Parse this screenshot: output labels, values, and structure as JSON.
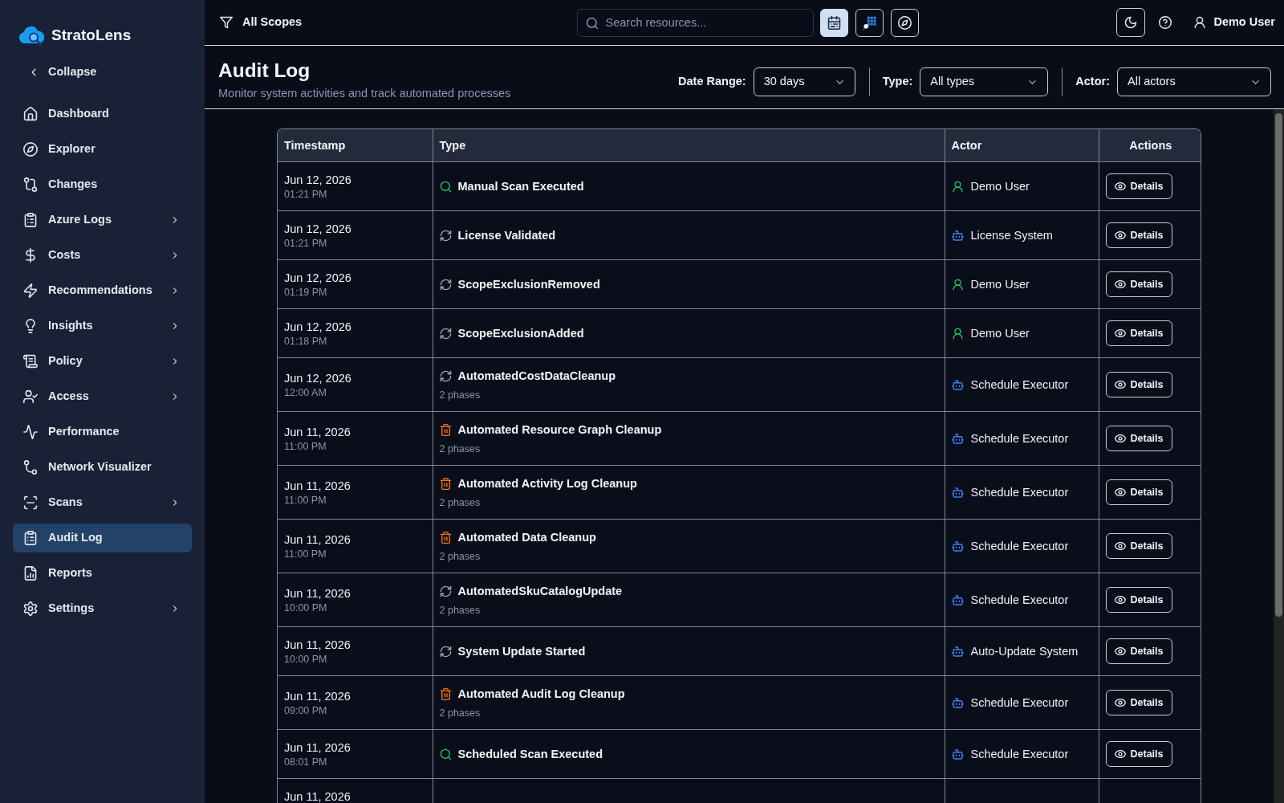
{
  "app": {
    "name": "StratoLens"
  },
  "sidebar": {
    "collapse_label": "Collapse",
    "items": [
      {
        "label": "Dashboard",
        "selected": false,
        "has_submenu": false
      },
      {
        "label": "Explorer",
        "selected": false,
        "has_submenu": false
      },
      {
        "label": "Changes",
        "selected": false,
        "has_submenu": false
      },
      {
        "label": "Azure Logs",
        "selected": false,
        "has_submenu": true
      },
      {
        "label": "Costs",
        "selected": false,
        "has_submenu": true
      },
      {
        "label": "Recommendations",
        "selected": false,
        "has_submenu": true
      },
      {
        "label": "Insights",
        "selected": false,
        "has_submenu": true
      },
      {
        "label": "Policy",
        "selected": false,
        "has_submenu": true
      },
      {
        "label": "Access",
        "selected": false,
        "has_submenu": true
      },
      {
        "label": "Performance",
        "selected": false,
        "has_submenu": false
      },
      {
        "label": "Network Visualizer",
        "selected": false,
        "has_submenu": false
      },
      {
        "label": "Scans",
        "selected": false,
        "has_submenu": true
      },
      {
        "label": "Audit Log",
        "selected": true,
        "has_submenu": false
      },
      {
        "label": "Reports",
        "selected": false,
        "has_submenu": false
      },
      {
        "label": "Settings",
        "selected": false,
        "has_submenu": true
      }
    ]
  },
  "top_bar": {
    "scope_filter": "All Scopes",
    "search": {
      "placeholder": "Search resources..."
    },
    "view_buttons": [
      {
        "selected": true
      },
      {
        "selected": false
      },
      {
        "selected": false
      }
    ],
    "user": "Demo User"
  },
  "header": {
    "title": "Audit Log",
    "subtitle": "Monitor system activities and track automated processes",
    "filters": [
      {
        "label": "Date Range:",
        "value": "30 days"
      },
      {
        "label": "Type:",
        "value": "All types"
      },
      {
        "label": "Actor:",
        "value": "All actors"
      }
    ]
  },
  "table": {
    "columns": [
      "Timestamp",
      "Type",
      "Actor",
      "Actions"
    ],
    "rows": [
      {
        "date": "Jun 12, 2026",
        "time": "01:21 PM",
        "event": {
          "kind": "scan",
          "label": "Manual Scan Executed"
        },
        "actor": {
          "kind": "user",
          "name": "Demo User"
        },
        "action": "Details"
      },
      {
        "date": "Jun 12, 2026",
        "time": "01:21 PM",
        "event": {
          "kind": "sync",
          "label": "License Validated"
        },
        "actor": {
          "kind": "system",
          "name": "License System"
        },
        "action": "Details"
      },
      {
        "date": "Jun 12, 2026",
        "time": "01:19 PM",
        "event": {
          "kind": "sync",
          "label": "ScopeExclusionRemoved"
        },
        "actor": {
          "kind": "user",
          "name": "Demo User"
        },
        "action": "Details"
      },
      {
        "date": "Jun 12, 2026",
        "time": "01:18 PM",
        "event": {
          "kind": "sync",
          "label": "ScopeExclusionAdded"
        },
        "actor": {
          "kind": "user",
          "name": "Demo User"
        },
        "action": "Details"
      },
      {
        "date": "Jun 12, 2026",
        "time": "12:00 AM",
        "event": {
          "kind": "sync",
          "label": "AutomatedCostDataCleanup",
          "phases": "2 phases"
        },
        "actor": {
          "kind": "system",
          "name": "Schedule Executor"
        },
        "action": "Details"
      },
      {
        "date": "Jun 11, 2026",
        "time": "11:00 PM",
        "event": {
          "kind": "cleanup",
          "label": "Automated Resource Graph Cleanup",
          "phases": "2 phases"
        },
        "actor": {
          "kind": "system",
          "name": "Schedule Executor"
        },
        "action": "Details"
      },
      {
        "date": "Jun 11, 2026",
        "time": "11:00 PM",
        "event": {
          "kind": "cleanup",
          "label": "Automated Activity Log Cleanup",
          "phases": "2 phases"
        },
        "actor": {
          "kind": "system",
          "name": "Schedule Executor"
        },
        "action": "Details"
      },
      {
        "date": "Jun 11, 2026",
        "time": "11:00 PM",
        "event": {
          "kind": "cleanup",
          "label": "Automated Data Cleanup",
          "phases": "2 phases"
        },
        "actor": {
          "kind": "system",
          "name": "Schedule Executor"
        },
        "action": "Details"
      },
      {
        "date": "Jun 11, 2026",
        "time": "10:00 PM",
        "event": {
          "kind": "sync",
          "label": "AutomatedSkuCatalogUpdate",
          "phases": "2 phases"
        },
        "actor": {
          "kind": "system",
          "name": "Schedule Executor"
        },
        "action": "Details"
      },
      {
        "date": "Jun 11, 2026",
        "time": "10:00 PM",
        "event": {
          "kind": "sync",
          "label": "System Update Started"
        },
        "actor": {
          "kind": "system",
          "name": "Auto-Update System"
        },
        "action": "Details"
      },
      {
        "date": "Jun 11, 2026",
        "time": "09:00 PM",
        "event": {
          "kind": "cleanup",
          "label": "Automated Audit Log Cleanup",
          "phases": "2 phases"
        },
        "actor": {
          "kind": "system",
          "name": "Schedule Executor"
        },
        "action": "Details"
      },
      {
        "date": "Jun 11, 2026",
        "time": "08:01 PM",
        "event": {
          "kind": "scan",
          "label": "Scheduled Scan Executed"
        },
        "actor": {
          "kind": "system",
          "name": "Schedule Executor"
        },
        "action": "Details"
      },
      {
        "date": "Jun 11, 2026"
      }
    ]
  }
}
